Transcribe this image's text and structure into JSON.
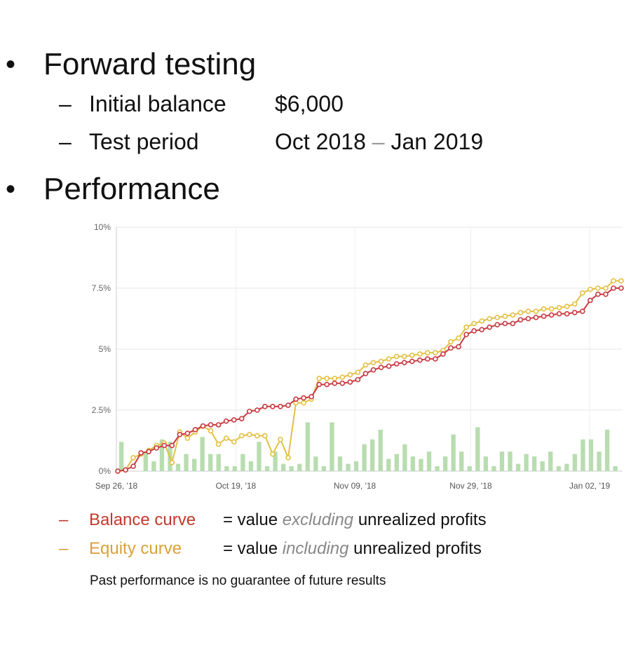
{
  "bullets": {
    "forward_testing": "Forward testing",
    "performance": "Performance",
    "bullet_char": "•"
  },
  "sub_items": {
    "dash": "–",
    "initial_balance_label": "Initial balance",
    "initial_balance_value": "$6,000",
    "test_period_label": "Test period",
    "test_period_start": "Oct 2018",
    "test_period_sep": "–",
    "test_period_end": "Jan 2019"
  },
  "legend": {
    "dash": "–",
    "balance_name": "Balance curve",
    "balance_desc_prefix": "= value",
    "balance_desc_em": "excluding",
    "balance_desc_suffix": "unrealized profits",
    "equity_name": "Equity curve",
    "equity_desc_prefix": "= value",
    "equity_desc_em": "including",
    "equity_desc_suffix": "unrealized profits"
  },
  "disclaimer": "Past performance is no guarantee of future results",
  "colors": {
    "balance": "#c8393f",
    "equity": "#e3c043",
    "bars": "#b8ddb0",
    "balance_text": "#c0392b",
    "equity_text": "#d9a23a"
  },
  "chart_data": {
    "type": "line",
    "ylim": [
      0,
      10
    ],
    "y_ticks": [
      "0%",
      "2.5%",
      "5%",
      "7.5%",
      "10%"
    ],
    "x_tick_labels": [
      "Sep 26, '18",
      "Oct 19, '18",
      "Nov 09, '18",
      "Nov 29, '18",
      "Jan 02, '19"
    ],
    "grid": true,
    "series": [
      {
        "name": "Balance curve",
        "values": [
          0,
          0.05,
          0.2,
          0.75,
          0.8,
          0.95,
          1.05,
          1.05,
          1.5,
          1.55,
          1.7,
          1.85,
          1.9,
          1.9,
          2.05,
          2.1,
          2.15,
          2.45,
          2.5,
          2.65,
          2.65,
          2.65,
          2.7,
          2.95,
          3.0,
          3.05,
          3.55,
          3.55,
          3.6,
          3.6,
          3.65,
          3.75,
          4.0,
          4.15,
          4.25,
          4.3,
          4.4,
          4.45,
          4.5,
          4.55,
          4.6,
          4.6,
          4.8,
          5.05,
          5.1,
          5.6,
          5.75,
          5.8,
          5.9,
          6.0,
          6.05,
          6.05,
          6.2,
          6.25,
          6.3,
          6.35,
          6.4,
          6.45,
          6.45,
          6.5,
          6.55,
          7.0,
          7.25,
          7.25,
          7.5,
          7.5
        ]
      },
      {
        "name": "Equity curve",
        "values": [
          0,
          0.05,
          0.55,
          0.7,
          0.85,
          1.05,
          1.15,
          0.35,
          1.6,
          1.35,
          1.6,
          1.85,
          1.65,
          1.1,
          1.35,
          1.2,
          1.45,
          1.5,
          1.45,
          1.45,
          0.7,
          1.3,
          0.55,
          2.8,
          2.8,
          2.95,
          3.8,
          3.8,
          3.8,
          3.85,
          3.95,
          4.05,
          4.35,
          4.45,
          4.5,
          4.6,
          4.7,
          4.7,
          4.75,
          4.8,
          4.85,
          4.85,
          4.95,
          5.3,
          5.45,
          5.9,
          6.05,
          6.15,
          6.25,
          6.3,
          6.35,
          6.4,
          6.5,
          6.55,
          6.55,
          6.65,
          6.65,
          6.7,
          6.75,
          6.85,
          7.3,
          7.45,
          7.5,
          7.5,
          7.8,
          7.8
        ]
      },
      {
        "name": "",
        "type": "bar",
        "values": [
          1.2,
          0,
          0,
          0.8,
          0.4,
          1.3,
          1.2,
          0.3,
          0.7,
          0.5,
          1.4,
          0.7,
          0.7,
          0.2,
          0.2,
          0.7,
          0.4,
          1.2,
          0.2,
          0.8,
          0.3,
          0.2,
          0.3,
          2.0,
          0.6,
          0.2,
          2.0,
          0.6,
          0.3,
          0.4,
          1.1,
          1.3,
          1.7,
          0.5,
          0.7,
          1.1,
          0.6,
          0.5,
          0.8,
          0.2,
          0.6,
          1.5,
          0.8,
          0.2,
          1.8,
          0.6,
          0.2,
          0.8,
          0.8,
          0.3,
          0.7,
          0.6,
          0.4,
          0.8,
          0.2,
          0.3,
          0.7,
          1.3,
          1.3,
          0.8,
          1.7,
          0.2
        ]
      }
    ]
  }
}
